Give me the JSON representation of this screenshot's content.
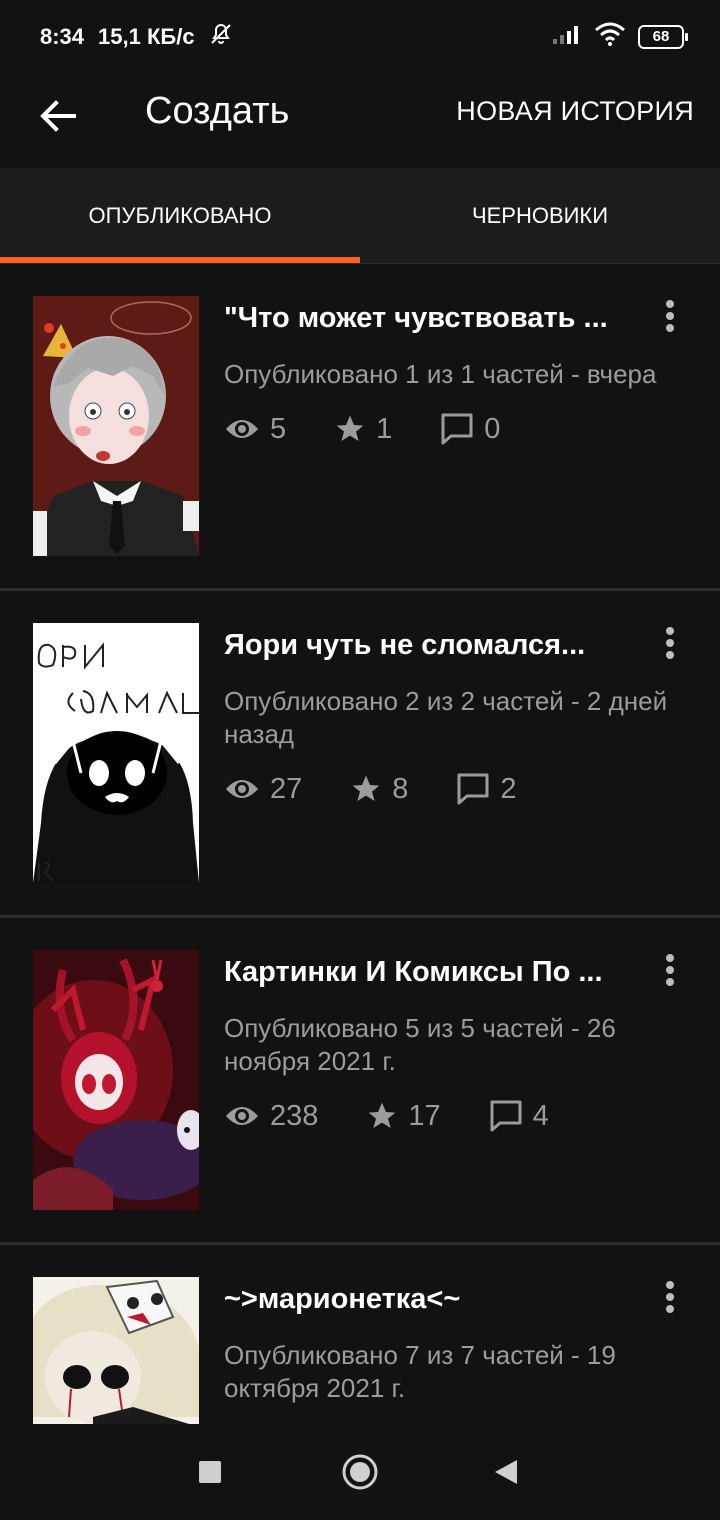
{
  "status_bar": {
    "time": "8:34",
    "speed": "15,1 КБ/с",
    "battery": "68"
  },
  "app_bar": {
    "title": "Создать",
    "new_story_label": "НОВАЯ ИСТОРИЯ"
  },
  "tabs": [
    {
      "label": "ОПУБЛИКОВАНО",
      "selected": true
    },
    {
      "label": "ЧЕРНОВИКИ",
      "selected": false
    }
  ],
  "accent_color": "#ff6122",
  "stories": [
    {
      "title": "\"Что может чувствовать ...",
      "meta": "Опубликовано 1 из 1 частей - вчера",
      "views": "5",
      "votes": "1",
      "comments": "0"
    },
    {
      "title": "Яори чуть не сломался...",
      "meta": "Опубликовано 2 из 2 частей - 2 дней назад",
      "views": "27",
      "votes": "8",
      "comments": "2"
    },
    {
      "title": "Картинки И Комиксы По ...",
      "meta": "Опубликовано 5 из 5 частей - 26 ноября 2021 г.",
      "views": "238",
      "votes": "17",
      "comments": "4"
    },
    {
      "title": "~>марионетка<~",
      "meta": "Опубликовано 7 из 7 частей - 19 октября 2021 г.",
      "views": "",
      "votes": "",
      "comments": ""
    }
  ]
}
